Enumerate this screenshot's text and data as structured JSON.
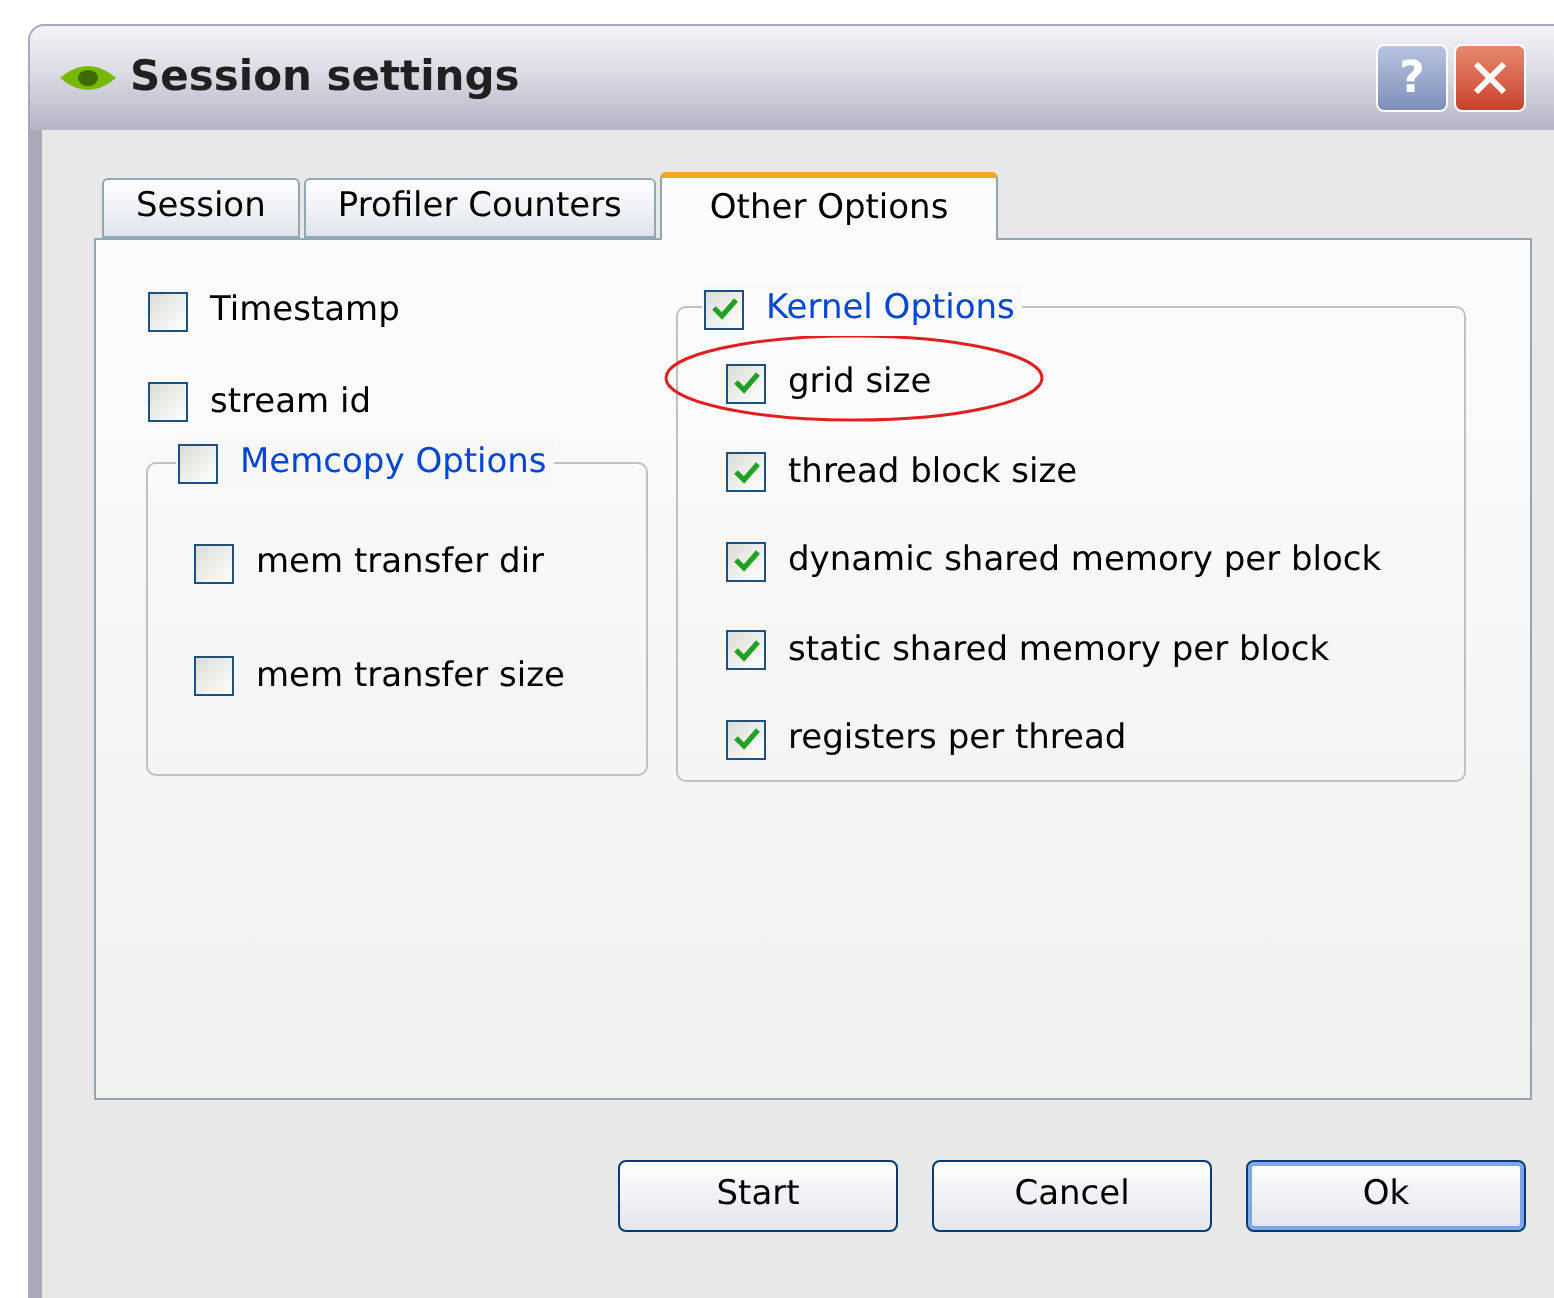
{
  "window": {
    "title": "Session settings"
  },
  "title_buttons": [
    {
      "kind": "help",
      "label": "?"
    },
    {
      "kind": "close"
    }
  ],
  "tabs": [
    {
      "label": "Session",
      "selected": false
    },
    {
      "label": "Profiler Counters",
      "selected": false
    },
    {
      "label": "Other Options",
      "selected": true
    }
  ],
  "left_options": [
    {
      "label": "Timestamp",
      "checked": false
    },
    {
      "label": "stream id",
      "checked": false
    }
  ],
  "memcopy_group": {
    "label": "Memcopy Options",
    "checked": false,
    "options": [
      {
        "label": "mem transfer dir",
        "checked": false
      },
      {
        "label": "mem transfer size",
        "checked": false
      }
    ]
  },
  "kernel_group": {
    "label": "Kernel Options",
    "checked": true,
    "options": [
      {
        "label": "grid size",
        "checked": true,
        "circled": true
      },
      {
        "label": "thread block size",
        "checked": true,
        "circled": false
      },
      {
        "label": "dynamic shared memory per block",
        "checked": true,
        "circled": false
      },
      {
        "label": "static shared memory per block",
        "checked": true,
        "circled": false
      },
      {
        "label": "registers per thread",
        "checked": true,
        "circled": false
      }
    ]
  },
  "buttons": [
    {
      "label": "Start",
      "focused": false
    },
    {
      "label": "Cancel",
      "focused": false
    },
    {
      "label": "Ok",
      "focused": true
    }
  ]
}
